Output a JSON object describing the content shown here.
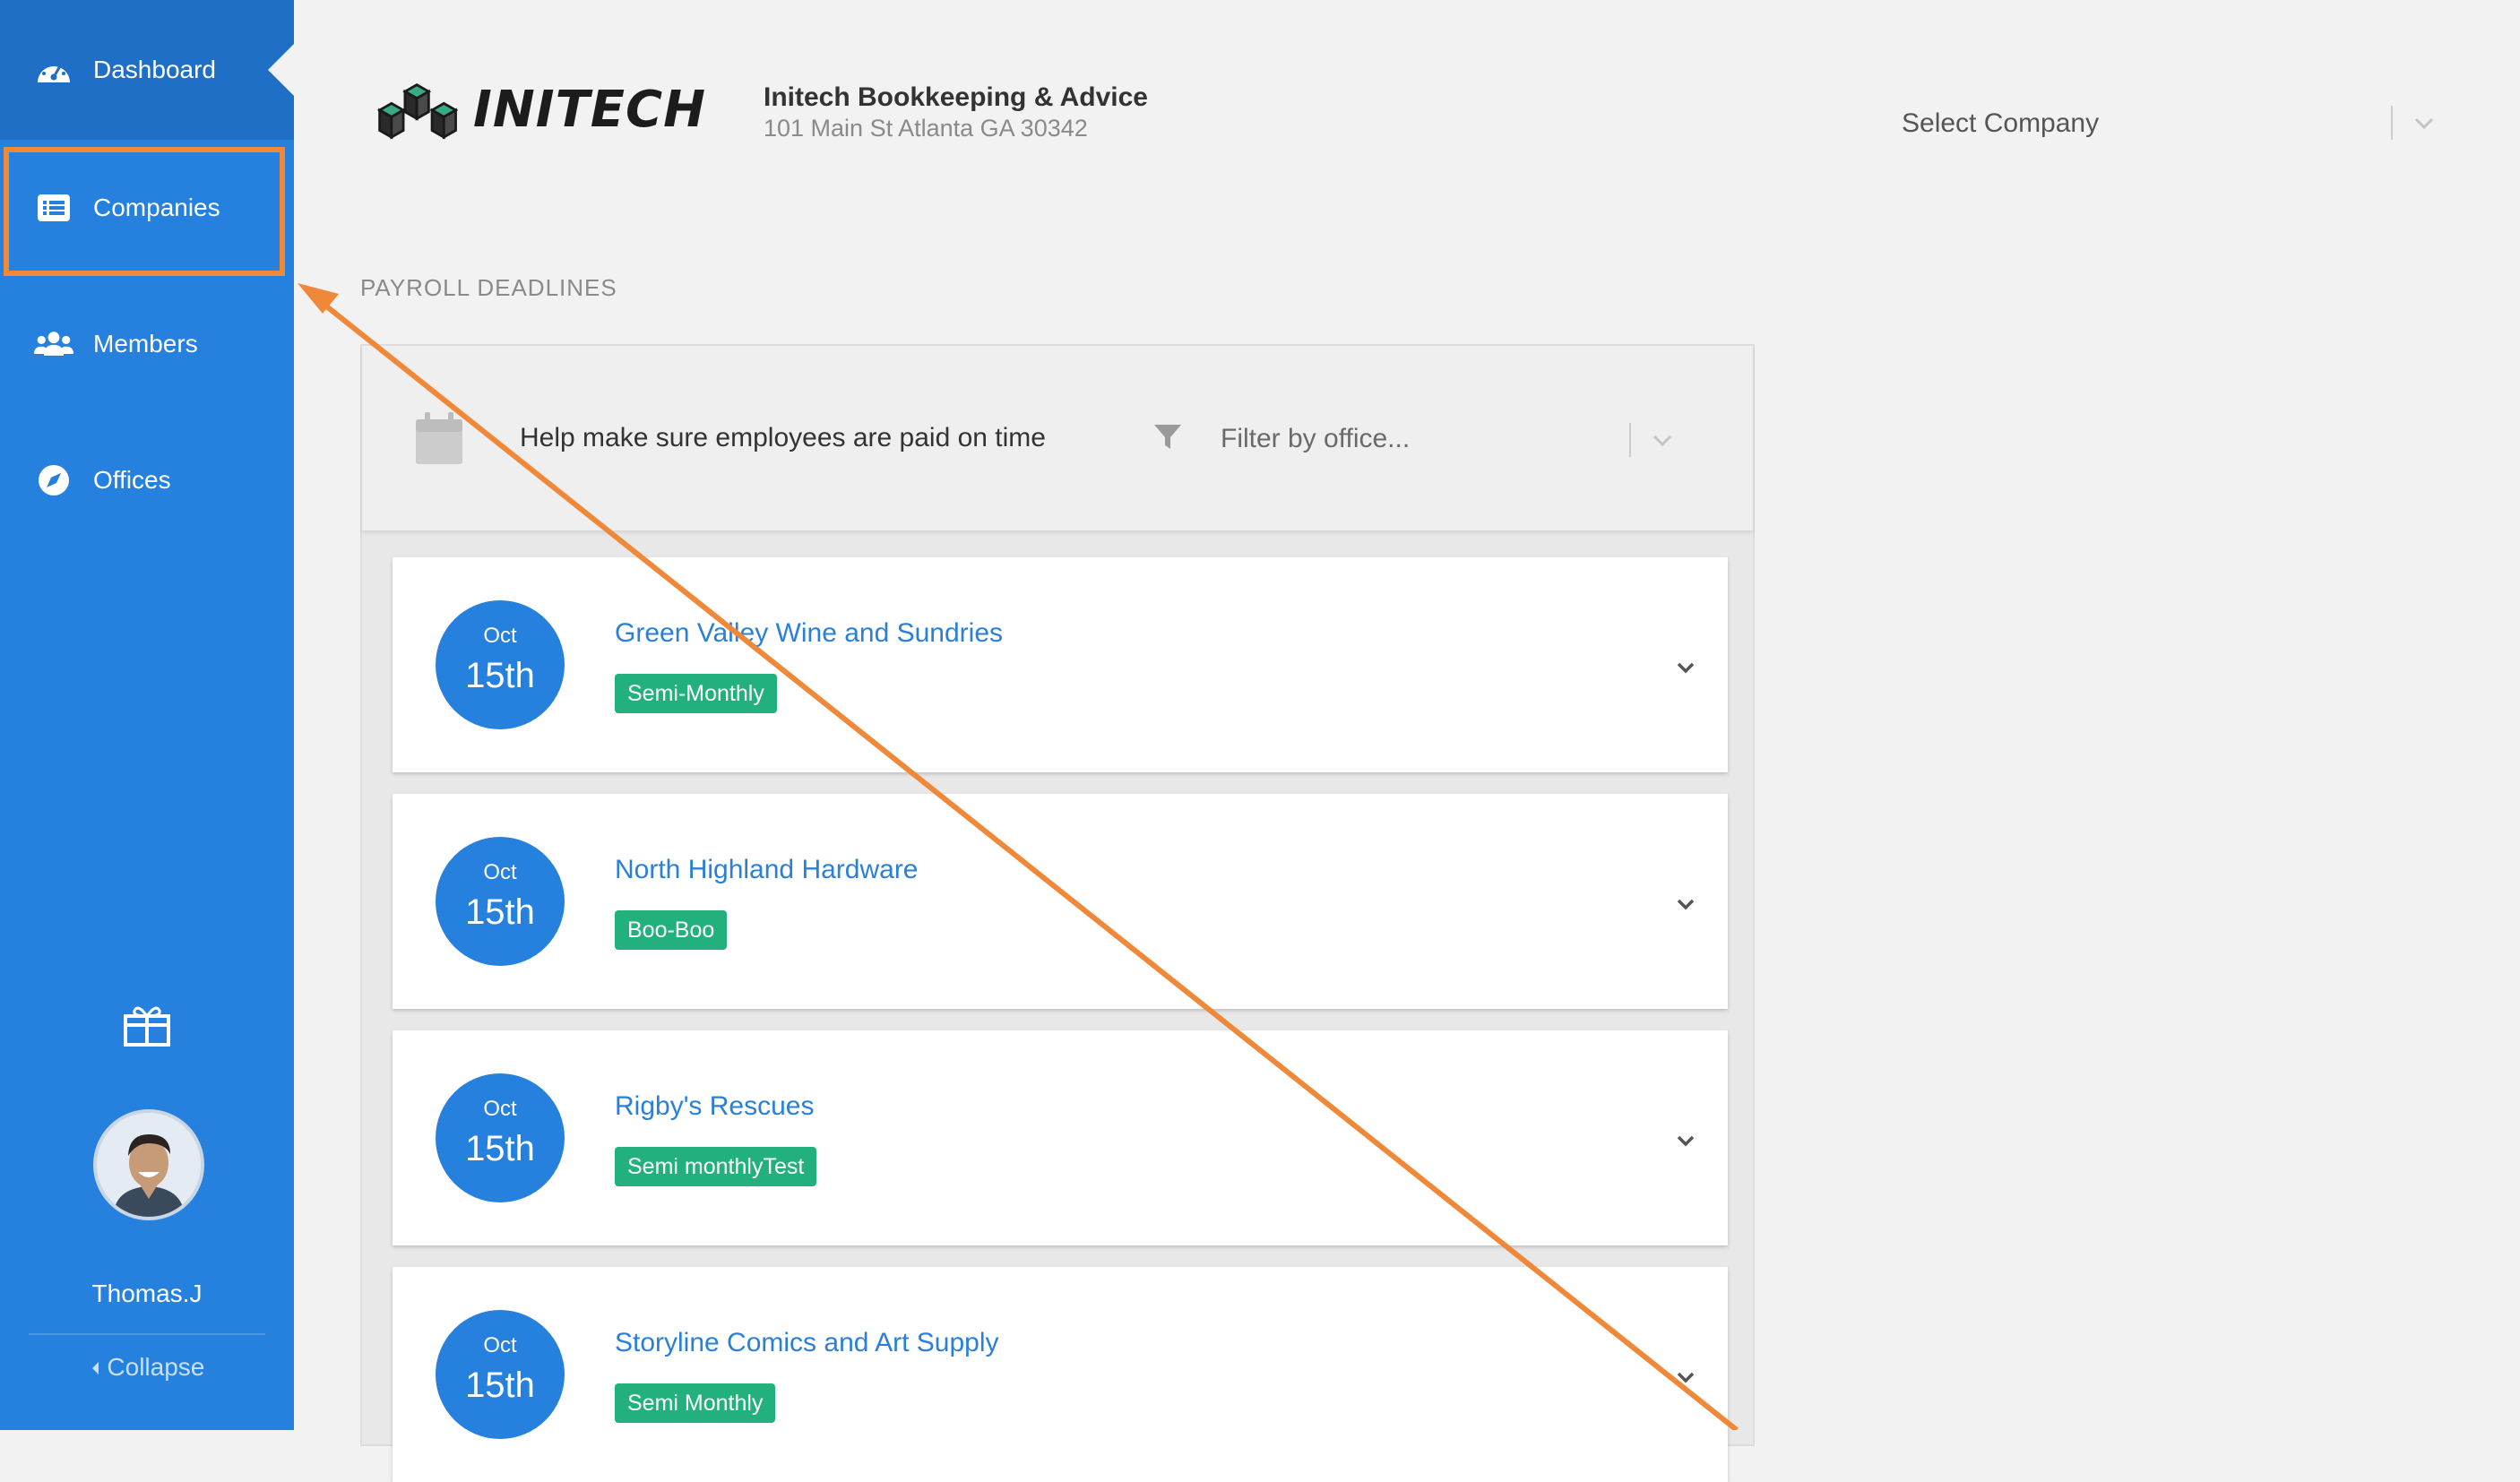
{
  "sidebar": {
    "items": [
      {
        "label": "Dashboard",
        "icon": "dashboard-gauge-icon"
      },
      {
        "label": "Companies",
        "icon": "list-icon"
      },
      {
        "label": "Members",
        "icon": "users-icon"
      },
      {
        "label": "Offices",
        "icon": "compass-icon"
      }
    ],
    "username": "Thomas.J",
    "collapse_label": "Collapse"
  },
  "header": {
    "logo_text": "INITECH",
    "company_name": "Initech Bookkeeping & Advice",
    "company_address": "101 Main St Atlanta GA 30342",
    "select_company_label": "Select Company"
  },
  "section": {
    "title": "PAYROLL DEADLINES"
  },
  "panel": {
    "help_text": "Help make sure employees are paid on time",
    "filter_placeholder": "Filter by office..."
  },
  "deadlines": [
    {
      "month": "Oct",
      "day": "15th",
      "company": "Green Valley Wine and Sundries",
      "frequency": "Semi-Monthly"
    },
    {
      "month": "Oct",
      "day": "15th",
      "company": "North Highland Hardware",
      "frequency": "Boo-Boo"
    },
    {
      "month": "Oct",
      "day": "15th",
      "company": "Rigby's Rescues",
      "frequency": "Semi monthlyTest"
    },
    {
      "month": "Oct",
      "day": "15th",
      "company": "Storyline Comics and Art Supply",
      "frequency": "Semi Monthly"
    }
  ],
  "colors": {
    "sidebar": "#2680de",
    "sidebar_active": "#1f6fc7",
    "accent_link": "#2a7fd6",
    "badge_green": "#22b07d",
    "annotation_orange": "#f0883a"
  }
}
